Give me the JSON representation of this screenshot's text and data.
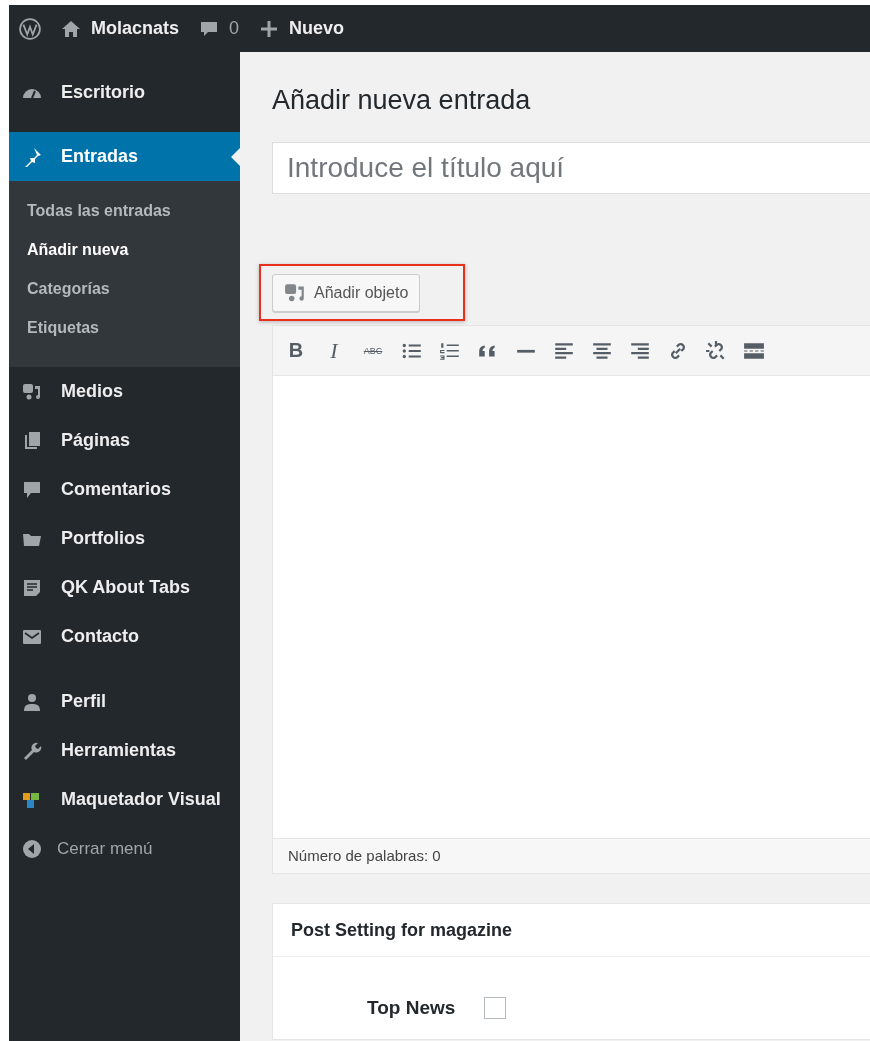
{
  "admin_bar": {
    "site_name": "Molacnats",
    "comments_count": "0",
    "new_label": "Nuevo"
  },
  "sidebar": {
    "groups": [
      [
        {
          "label": "Escritorio",
          "kind": "gauge",
          "selected": false
        }
      ],
      [
        {
          "label": "Entradas",
          "kind": "pin",
          "selected": true,
          "children": [
            {
              "label": "Todas las entradas",
              "selected": false
            },
            {
              "label": "Añadir nueva",
              "selected": true
            },
            {
              "label": "Categorías",
              "selected": false
            },
            {
              "label": "Etiquetas",
              "selected": false
            }
          ]
        },
        {
          "label": "Medios",
          "kind": "media",
          "selected": false
        },
        {
          "label": "Páginas",
          "kind": "pages",
          "selected": false
        },
        {
          "label": "Comentarios",
          "kind": "comment",
          "selected": false
        },
        {
          "label": "Portfolios",
          "kind": "folder",
          "selected": false
        },
        {
          "label": "QK About Tabs",
          "kind": "note",
          "selected": false
        },
        {
          "label": "Contacto",
          "kind": "mail",
          "selected": false
        }
      ],
      [
        {
          "label": "Perfil",
          "kind": "user",
          "selected": false
        },
        {
          "label": "Herramientas",
          "kind": "wrench",
          "selected": false
        },
        {
          "label": "Maquetador Visual",
          "kind": "blocks",
          "selected": false
        }
      ]
    ],
    "collapse_label": "Cerrar menú"
  },
  "page_title": "Añadir nueva entrada",
  "title_field": {
    "placeholder": "Introduce el título aquí"
  },
  "add_media_button": {
    "label": "Añadir objeto",
    "highlighted": true
  },
  "editor_toolbar": [
    {
      "kind": "bold",
      "glyph": "B"
    },
    {
      "kind": "italic",
      "glyph": "I"
    },
    {
      "kind": "strike",
      "glyph": "ABC"
    },
    {
      "kind": "bullets"
    },
    {
      "kind": "numbers"
    },
    {
      "kind": "quote"
    },
    {
      "kind": "rule"
    },
    {
      "kind": "align-left"
    },
    {
      "kind": "align-center"
    },
    {
      "kind": "align-right"
    },
    {
      "kind": "link"
    },
    {
      "kind": "unlink"
    },
    {
      "kind": "more"
    }
  ],
  "word_count": "Número de palabras: 0",
  "metabox": {
    "title": "Post Setting for magazine",
    "fields": [
      {
        "label": "Top News",
        "checked": false
      }
    ]
  }
}
